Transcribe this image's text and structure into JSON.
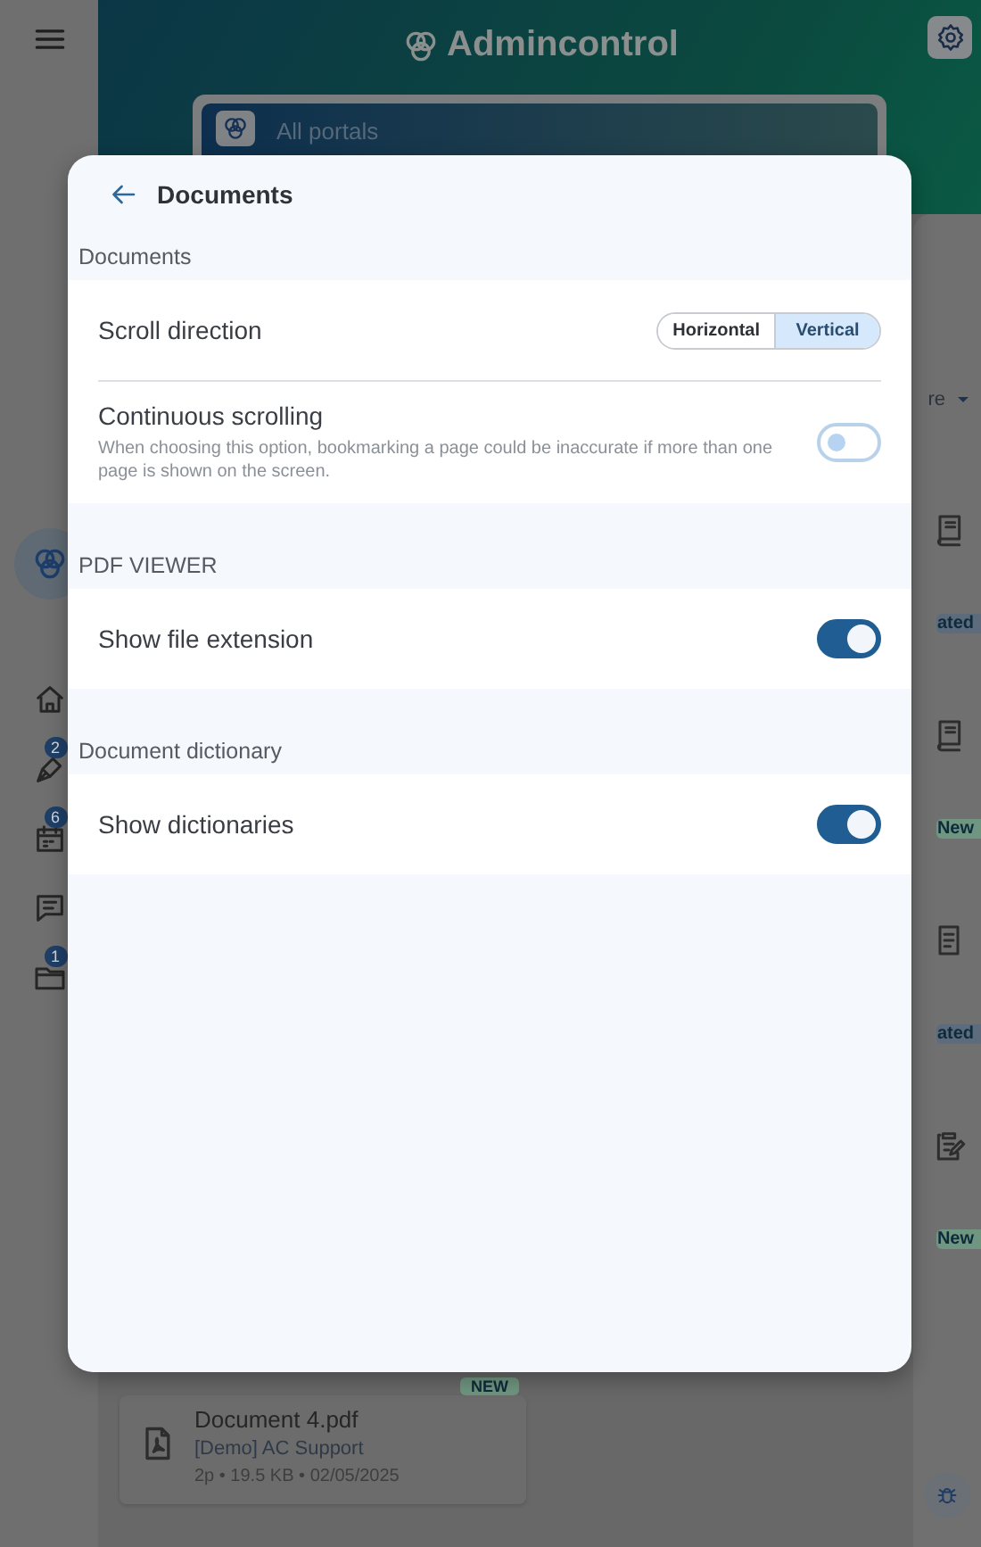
{
  "background": {
    "app_title": "Admincontrol",
    "portal_selector": {
      "value": "All portals"
    },
    "nav": [
      {
        "kind": "home"
      },
      {
        "kind": "pen",
        "badge": "2"
      },
      {
        "kind": "calendar",
        "badge": "6"
      },
      {
        "kind": "chat"
      },
      {
        "kind": "folder",
        "badge": "1"
      }
    ],
    "sort_fragment": "re",
    "documents": [
      {
        "kind": "book",
        "tag": "ated",
        "color": "#5d6c7c"
      },
      {
        "kind": "book",
        "tag": "New",
        "color": "#6f9680"
      },
      {
        "kind": "document",
        "tag": "ated",
        "color": "#5d6c7c"
      },
      {
        "kind": "clipboard",
        "tag": "New",
        "color": "#6f9680"
      }
    ],
    "last_document": {
      "name": "Document 4.pdf",
      "portal": "[Demo] AC Support",
      "meta": "2p • 19.5 KB • 02/05/2025",
      "tag": "NEW",
      "color": "#6f9680"
    }
  },
  "dialog": {
    "title": "Documents",
    "sections": [
      {
        "heading": "Documents",
        "rows": [
          {
            "kind": "segmented",
            "label": "Scroll direction",
            "options": [
              {
                "label": "Horizontal",
                "selected": false
              },
              {
                "label": "Vertical",
                "selected": true
              }
            ]
          },
          {
            "kind": "toggle",
            "label": "Continuous scrolling",
            "description": "When choosing this option, bookmarking a page could be inaccurate if more than one page is shown on the screen.",
            "on": false
          }
        ]
      },
      {
        "heading": "PDF VIEWER",
        "rows": [
          {
            "kind": "toggle",
            "label": "Show file extension",
            "on": true
          }
        ]
      },
      {
        "heading": "Document dictionary",
        "rows": [
          {
            "kind": "toggle",
            "label": "Show dictionaries",
            "on": true
          }
        ]
      }
    ]
  }
}
